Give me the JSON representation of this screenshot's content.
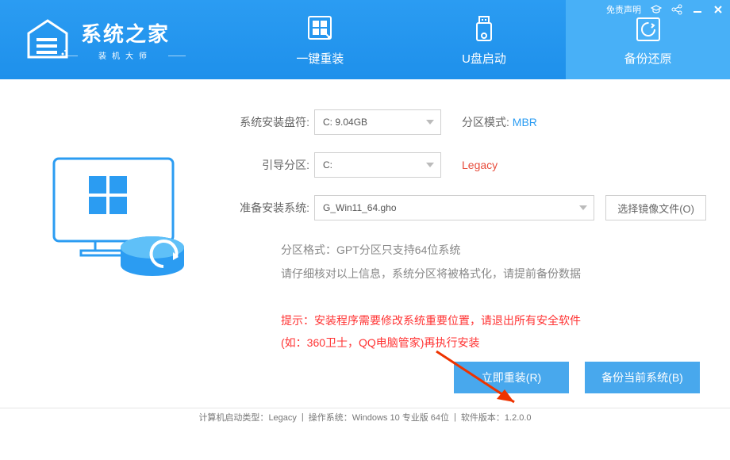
{
  "header": {
    "title": "系统之家",
    "subtitle": "装机大师",
    "disclaimer": "免责声明"
  },
  "tabs": [
    {
      "label": "一键重装",
      "active": false
    },
    {
      "label": "U盘启动",
      "active": false
    },
    {
      "label": "备份还原",
      "active": true
    }
  ],
  "form": {
    "disk_label": "系统安装盘符:",
    "disk_value": "C: 9.04GB",
    "partition_mode_label": "分区模式:",
    "partition_mode_value": "MBR",
    "boot_label": "引导分区:",
    "boot_value": "C:",
    "boot_mode_value": "Legacy",
    "image_label": "准备安装系统:",
    "image_value": "G_Win11_64.gho",
    "image_btn": "选择镜像文件(O)"
  },
  "hints": {
    "line1": "分区格式：GPT分区只支持64位系统",
    "line2": "请仔细核对以上信息，系统分区将被格式化，请提前备份数据"
  },
  "warning": {
    "line1": "提示：安装程序需要修改系统重要位置，请退出所有安全软件",
    "line2": "(如：360卫士，QQ电脑管家)再执行安装"
  },
  "actions": {
    "reinstall": "立即重装(R)",
    "backup": "备份当前系统(B)"
  },
  "status": {
    "boot_type_label": "计算机启动类型：",
    "boot_type": "Legacy",
    "os_label": "操作系统：",
    "os": "Windows 10 专业版 64位",
    "ver_label": "软件版本：",
    "ver": "1.2.0.0"
  }
}
